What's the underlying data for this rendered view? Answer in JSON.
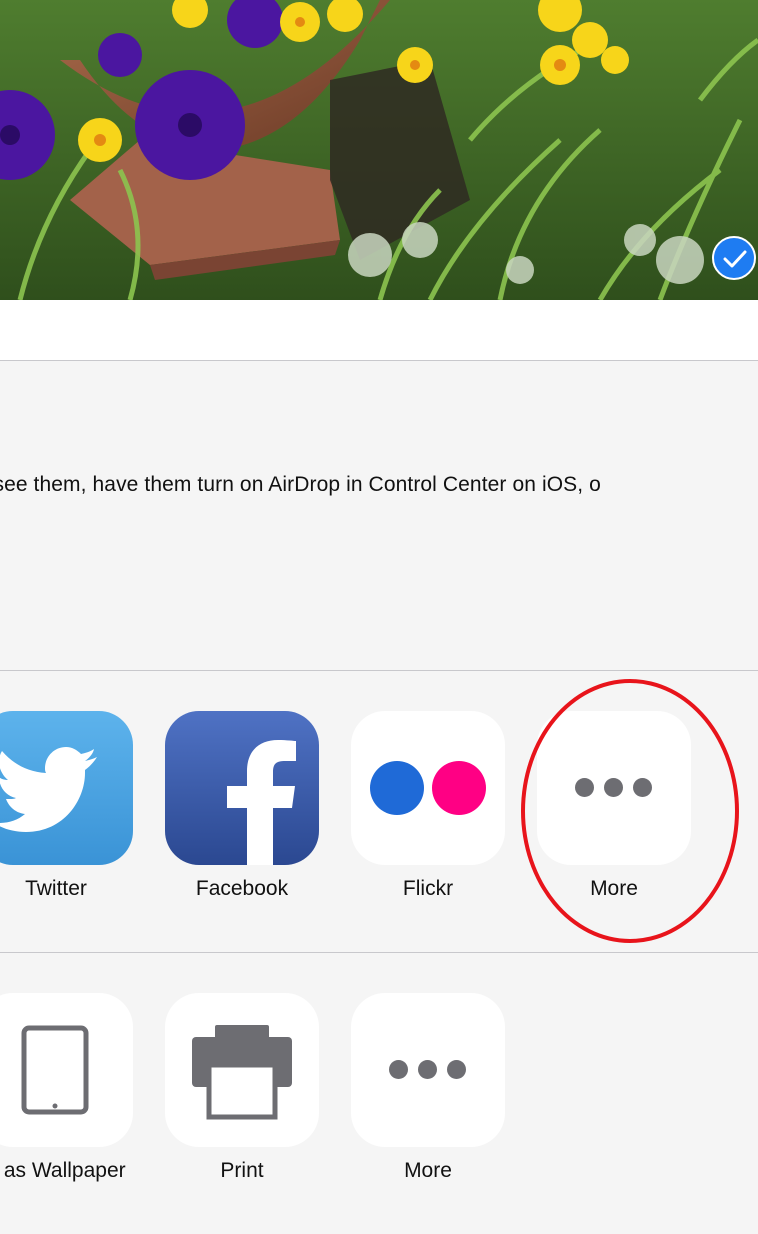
{
  "photo": {
    "selected": true
  },
  "airdrop": {
    "hint": "ou don’t see them, have them turn on AirDrop in Control Center on iOS, o"
  },
  "share_apps": [
    {
      "label": "Twitter",
      "icon": "twitter-icon"
    },
    {
      "label": "Facebook",
      "icon": "facebook-icon"
    },
    {
      "label": "Flickr",
      "icon": "flickr-icon"
    },
    {
      "label": "More",
      "icon": "more-dots-icon"
    }
  ],
  "actions": [
    {
      "label": "e as Wallpaper",
      "icon": "ipad-icon"
    },
    {
      "label": "Print",
      "icon": "printer-icon"
    },
    {
      "label": "More",
      "icon": "more-dots-icon"
    }
  ],
  "colors": {
    "selection_blue": "#1e7cf2",
    "highlight_red": "#e8141b",
    "flickr_blue": "#1f6ad7",
    "flickr_pink": "#ff0084",
    "sheet_background": "#f5f5f5"
  }
}
